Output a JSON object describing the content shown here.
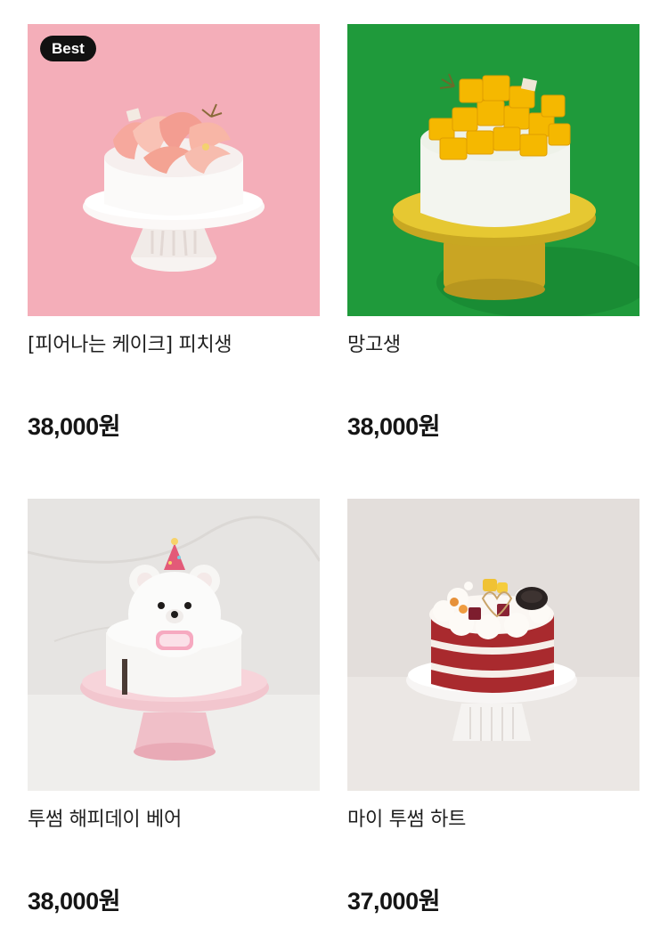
{
  "products": [
    {
      "name": "[피어나는 케이크] 피치생",
      "price": "38,000원",
      "badge": "Best",
      "image": "peach-cake-photo",
      "bg_color": "#f4aeb9"
    },
    {
      "name": "망고생",
      "price": "38,000원",
      "image": "mango-cake-photo",
      "bg_color": "#1f9a3b"
    },
    {
      "name": "투썸 해피데이 베어",
      "price": "38,000원",
      "image": "bear-cake-photo",
      "bg_color": "#e6e4e2"
    },
    {
      "name": "마이 투썸 하트",
      "price": "37,000원",
      "image": "red-velvet-heart-cake-photo",
      "bg_color": "#e3dedb"
    }
  ]
}
